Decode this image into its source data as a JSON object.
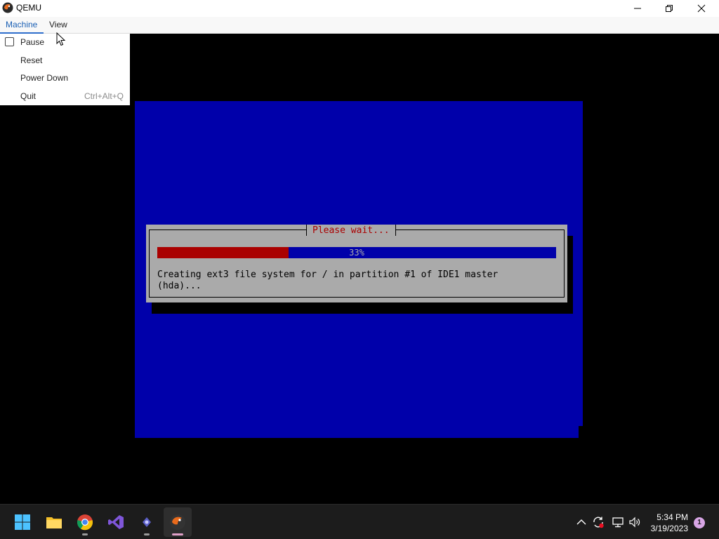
{
  "window": {
    "title": "QEMU",
    "colors": {
      "titlebar_bg": "#ffffff",
      "menu_active": "#1a5fb4"
    }
  },
  "menubar": {
    "items": [
      {
        "label": "Machine",
        "active": true
      },
      {
        "label": "View",
        "active": false
      }
    ]
  },
  "machine_menu": {
    "items": [
      {
        "label": "Pause",
        "checkbox": true,
        "checked": false,
        "shortcut": ""
      },
      {
        "label": "Reset",
        "shortcut": ""
      },
      {
        "label": "Power Down",
        "shortcut": ""
      },
      {
        "label": "Quit",
        "shortcut": "Ctrl+Alt+Q"
      }
    ]
  },
  "installer": {
    "dialog_title": "Please wait...",
    "progress_percent": 33,
    "progress_label": "33%",
    "message": "Creating ext3 file system for / in partition #1 of IDE1 master\n(hda)...",
    "colors": {
      "screen_bg": "#0000aa",
      "dialog_bg": "#aaaaaa",
      "title_color": "#aa0000",
      "progress_fill": "#aa0000"
    }
  },
  "taskbar": {
    "pinned": [
      "windows-start-icon",
      "file-explorer-icon",
      "chrome-icon",
      "visual-studio-icon",
      "teams-icon",
      "qemu-icon"
    ],
    "tray": [
      "chevron-up-icon",
      "sync-icon",
      "network-icon",
      "volume-icon"
    ],
    "clock_time": "5:34 PM",
    "clock_date": "3/19/2023",
    "notification_count": "1"
  }
}
